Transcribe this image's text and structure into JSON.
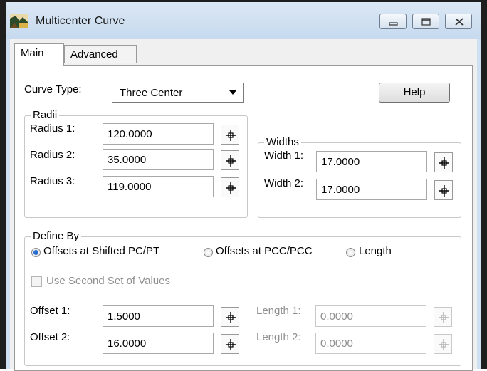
{
  "window": {
    "title": "Multicenter Curve"
  },
  "icons": {
    "app": "app-logo-icon",
    "minimize": "minimize-icon",
    "maximize": "maximize-icon",
    "close": "close-icon",
    "pick": "crosshair-pick-icon",
    "dropdown": "chevron-down-icon"
  },
  "tabs": [
    {
      "label": "Main",
      "active": true
    },
    {
      "label": "Advanced",
      "active": false
    }
  ],
  "curve_type": {
    "label": "Curve Type:",
    "value": "Three Center"
  },
  "help_button": "Help",
  "radii": {
    "legend": "Radii",
    "rows": [
      {
        "label": "Radius 1:",
        "value": "120.0000"
      },
      {
        "label": "Radius 2:",
        "value": "35.0000"
      },
      {
        "label": "Radius 3:",
        "value": "119.0000"
      }
    ]
  },
  "widths": {
    "legend": "Widths",
    "rows": [
      {
        "label": "Width 1:",
        "value": "17.0000"
      },
      {
        "label": "Width 2:",
        "value": "17.0000"
      }
    ]
  },
  "define_by": {
    "legend": "Define By",
    "options": [
      {
        "label": "Offsets at Shifted PC/PT",
        "selected": true
      },
      {
        "label": "Offsets at PCC/PCC",
        "selected": false
      },
      {
        "label": "Length",
        "selected": false
      }
    ],
    "second_set": {
      "label": "Use Second Set of Values",
      "checked": false,
      "enabled": false
    },
    "offsets": [
      {
        "label": "Offset 1:",
        "value": "1.5000"
      },
      {
        "label": "Offset 2:",
        "value": "16.0000"
      }
    ],
    "lengths": [
      {
        "label": "Length 1:",
        "value": "0.0000",
        "enabled": false
      },
      {
        "label": "Length 2:",
        "value": "0.0000",
        "enabled": false
      }
    ]
  },
  "colors": {
    "titlebar": "#cfe0f2",
    "selected_radio": "#2a6fd0",
    "disabled_text": "#8f8f8f"
  }
}
